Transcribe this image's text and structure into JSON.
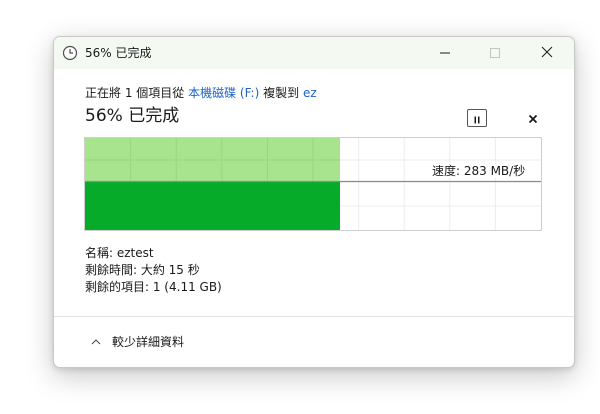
{
  "window": {
    "title": "56% 已完成"
  },
  "transfer": {
    "prefix": "正在將 1 個項目從 ",
    "source": "本機磁碟 (F:)",
    "middle": " 複製到 ",
    "destination": "ez",
    "percent_text": "56% 已完成",
    "progress_fraction": 0.56,
    "speed_text": "速度: 283 MB/秒"
  },
  "details": {
    "name_text": "名稱: eztest",
    "time_text": "剩餘時間: 大約 15 秒",
    "items_text": "剩餘的項目: 1 (4.11 GB)",
    "toggle_label": "較少詳細資料"
  },
  "colors": {
    "progress_fill": "#06ab2a",
    "history_fill": "#a8e38e",
    "link": "#1f63c6"
  },
  "icons": {
    "title": "clock-icon",
    "minimize": "minimize-icon",
    "maximize": "maximize-icon",
    "close": "close-icon",
    "pause": "pause-icon",
    "cancel": "cancel-icon",
    "toggle": "chevron-up-icon"
  }
}
